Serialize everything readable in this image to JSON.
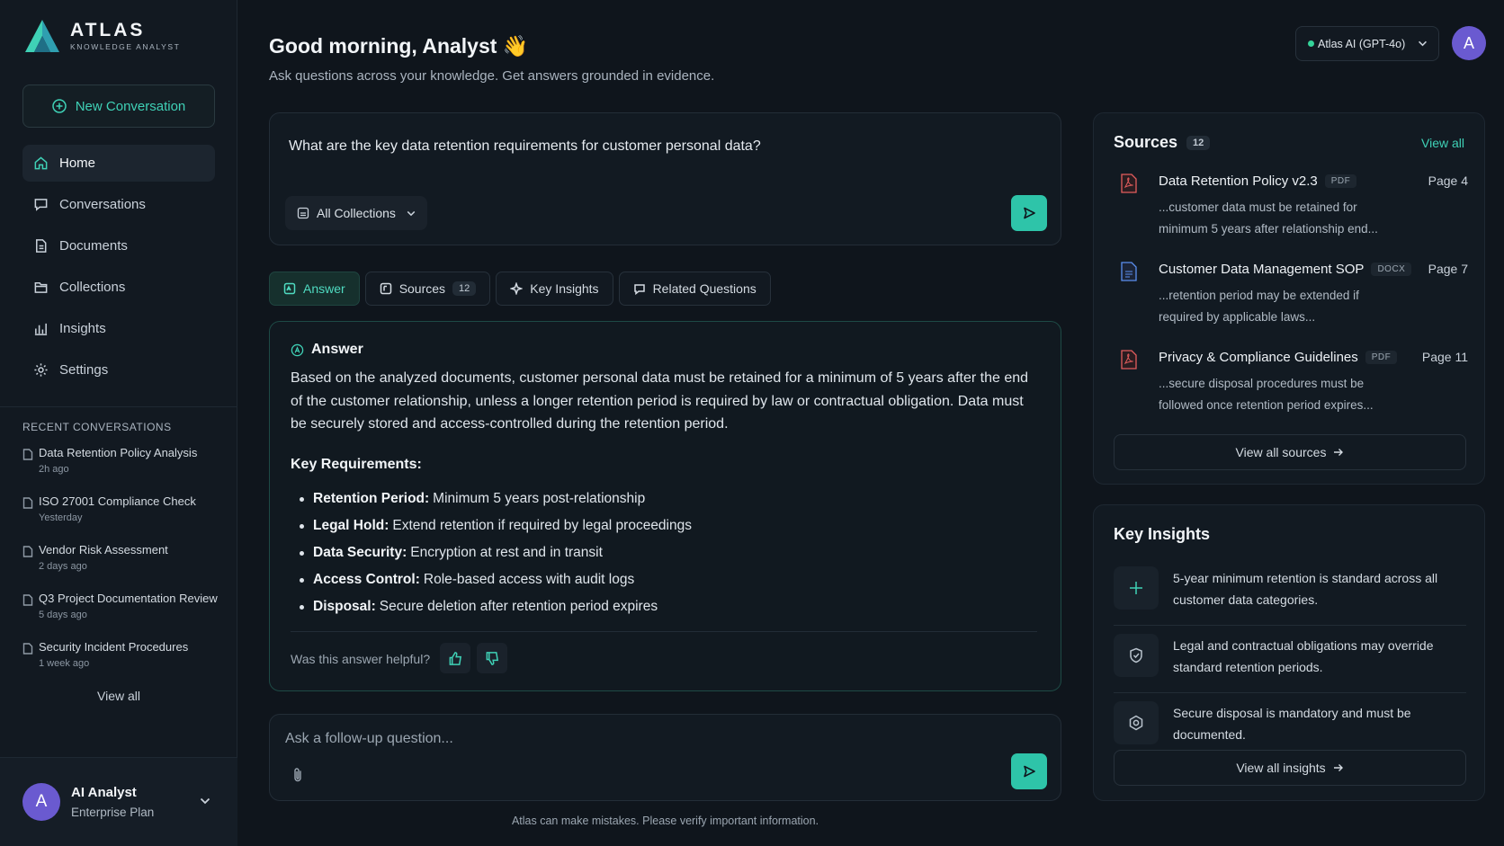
{
  "brand": {
    "name": "ATLAS",
    "tagline": "KNOWLEDGE ANALYST"
  },
  "sidebar": {
    "new_conversation": "New Conversation",
    "nav": [
      {
        "label": "Home",
        "icon": "home-icon"
      },
      {
        "label": "Conversations",
        "icon": "chat-icon"
      },
      {
        "label": "Documents",
        "icon": "document-icon"
      },
      {
        "label": "Collections",
        "icon": "folder-icon"
      },
      {
        "label": "Insights",
        "icon": "chart-icon"
      },
      {
        "label": "Settings",
        "icon": "gear-icon"
      }
    ],
    "recent_title": "RECENT CONVERSATIONS",
    "recent": [
      {
        "title": "Data Retention Policy Analysis",
        "time": "2h ago"
      },
      {
        "title": "ISO 27001 Compliance Check",
        "time": "Yesterday"
      },
      {
        "title": "Vendor Risk Assessment",
        "time": "2 days ago"
      },
      {
        "title": "Q3 Project Documentation Review",
        "time": "5 days ago"
      },
      {
        "title": "Security Incident Procedures",
        "time": "1 week ago"
      }
    ],
    "view_all": "View all",
    "user": {
      "initial": "A",
      "name": "AI Analyst",
      "plan": "Enterprise Plan"
    }
  },
  "header": {
    "greeting": "Good morning, Analyst",
    "wave": "👋",
    "subtitle": "Ask questions across your knowledge. Get answers grounded in evidence.",
    "model": "Atlas AI (GPT-4o)",
    "avatar_initial": "A"
  },
  "query": {
    "text": "What are the key data retention requirements for customer personal data?",
    "collection": "All Collections"
  },
  "tabs": [
    {
      "label": "Answer",
      "icon": "answer-icon"
    },
    {
      "label": "Sources",
      "count": "12",
      "icon": "sources-icon"
    },
    {
      "label": "Key Insights",
      "icon": "sparkle-icon"
    },
    {
      "label": "Related Questions",
      "icon": "question-icon"
    }
  ],
  "answer": {
    "title": "Answer",
    "body": "Based on the analyzed documents, customer personal data must be retained for a minimum of 5 years after the end of the customer relationship, unless a longer retention period is required by law or contractual obligation. Data must be securely stored and access-controlled during the retention period.",
    "requirements_title": "Key Requirements:",
    "requirements": [
      {
        "label": "Retention Period:",
        "text": "Minimum 5 years post-relationship"
      },
      {
        "label": "Legal Hold:",
        "text": "Extend retention if required by legal proceedings"
      },
      {
        "label": "Data Security:",
        "text": "Encryption at rest and in transit"
      },
      {
        "label": "Access Control:",
        "text": "Role-based access with audit logs"
      },
      {
        "label": "Disposal:",
        "text": "Secure deletion after retention period expires"
      }
    ],
    "helpful": "Was this answer helpful?"
  },
  "followup": {
    "placeholder": "Ask a follow-up question..."
  },
  "disclaimer": "Atlas can make mistakes. Please verify important information.",
  "sources": {
    "title": "Sources",
    "count": "12",
    "view_all": "View all",
    "items": [
      {
        "title": "Data Retention Policy v2.3",
        "type": "PDF",
        "page": "Page 4",
        "snippet": "...customer data must be retained for minimum 5 years after relationship end..."
      },
      {
        "title": "Customer Data Management SOP",
        "type": "DOCX",
        "page": "Page 7",
        "snippet": "...retention period may be extended if required by applicable laws..."
      },
      {
        "title": "Privacy & Compliance Guidelines",
        "type": "PDF",
        "page": "Page 11",
        "snippet": "...secure disposal procedures must be followed once retention period expires..."
      }
    ],
    "view_all_sources": "View all sources"
  },
  "insights": {
    "title": "Key Insights",
    "items": [
      {
        "text": "5-year minimum retention is standard across all customer data categories.",
        "icon": "sparkle-icon"
      },
      {
        "text": "Legal and contractual obligations may override standard retention periods.",
        "icon": "shield-icon"
      },
      {
        "text": "Secure disposal is mandatory and must be documented.",
        "icon": "disposal-icon"
      }
    ],
    "view_all": "View all insights"
  },
  "colors": {
    "accent": "#2ec4a9",
    "background": "#0f151c",
    "avatar": "#6a5ad0",
    "pdf": "#e35d5d",
    "docx": "#5b8ff0"
  }
}
